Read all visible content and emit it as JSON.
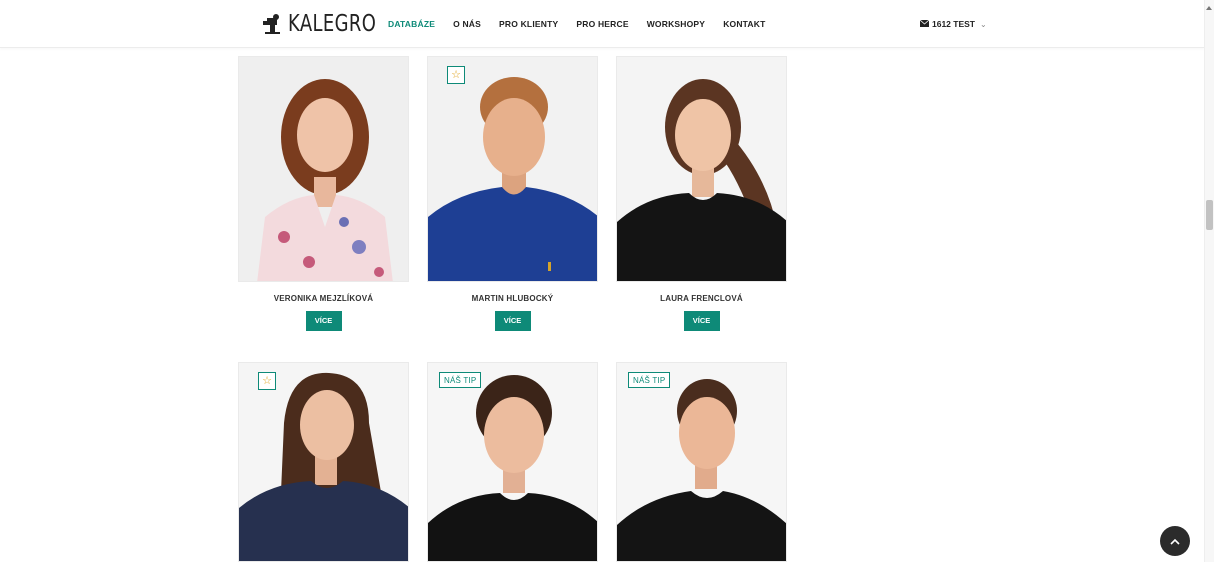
{
  "brand": {
    "name": "KALEGRO"
  },
  "nav": [
    {
      "label": "DATABÁZE",
      "active": true
    },
    {
      "label": "O NÁS",
      "active": false
    },
    {
      "label": "PRO KLIENTY",
      "active": false
    },
    {
      "label": "PRO HERCE",
      "active": false
    },
    {
      "label": "WORKSHOPY",
      "active": false
    },
    {
      "label": "KONTAKT",
      "active": false
    }
  ],
  "account": {
    "label": "1612 TEST",
    "icon": "envelope-icon"
  },
  "actors": [
    {
      "name": "VERONIKA MEJZLÍKOVÁ",
      "button": "VÍCE",
      "badge": "",
      "badge_icon": ""
    },
    {
      "name": "MARTIN HLUBOCKÝ",
      "button": "VÍCE",
      "badge": "",
      "badge_icon": "star-icon"
    },
    {
      "name": "LAURA FRENCLOVÁ",
      "button": "VÍCE",
      "badge": "",
      "badge_icon": ""
    },
    {
      "name": "",
      "button": "",
      "badge": "",
      "badge_icon": "star-icon"
    },
    {
      "name": "",
      "button": "",
      "badge": "NÁŠ TIP",
      "badge_icon": ""
    },
    {
      "name": "",
      "button": "",
      "badge": "NÁŠ TIP",
      "badge_icon": ""
    }
  ],
  "colors": {
    "accent": "#0e8a78",
    "star": "#e0a21a",
    "top_button": "#2b2b2b"
  }
}
